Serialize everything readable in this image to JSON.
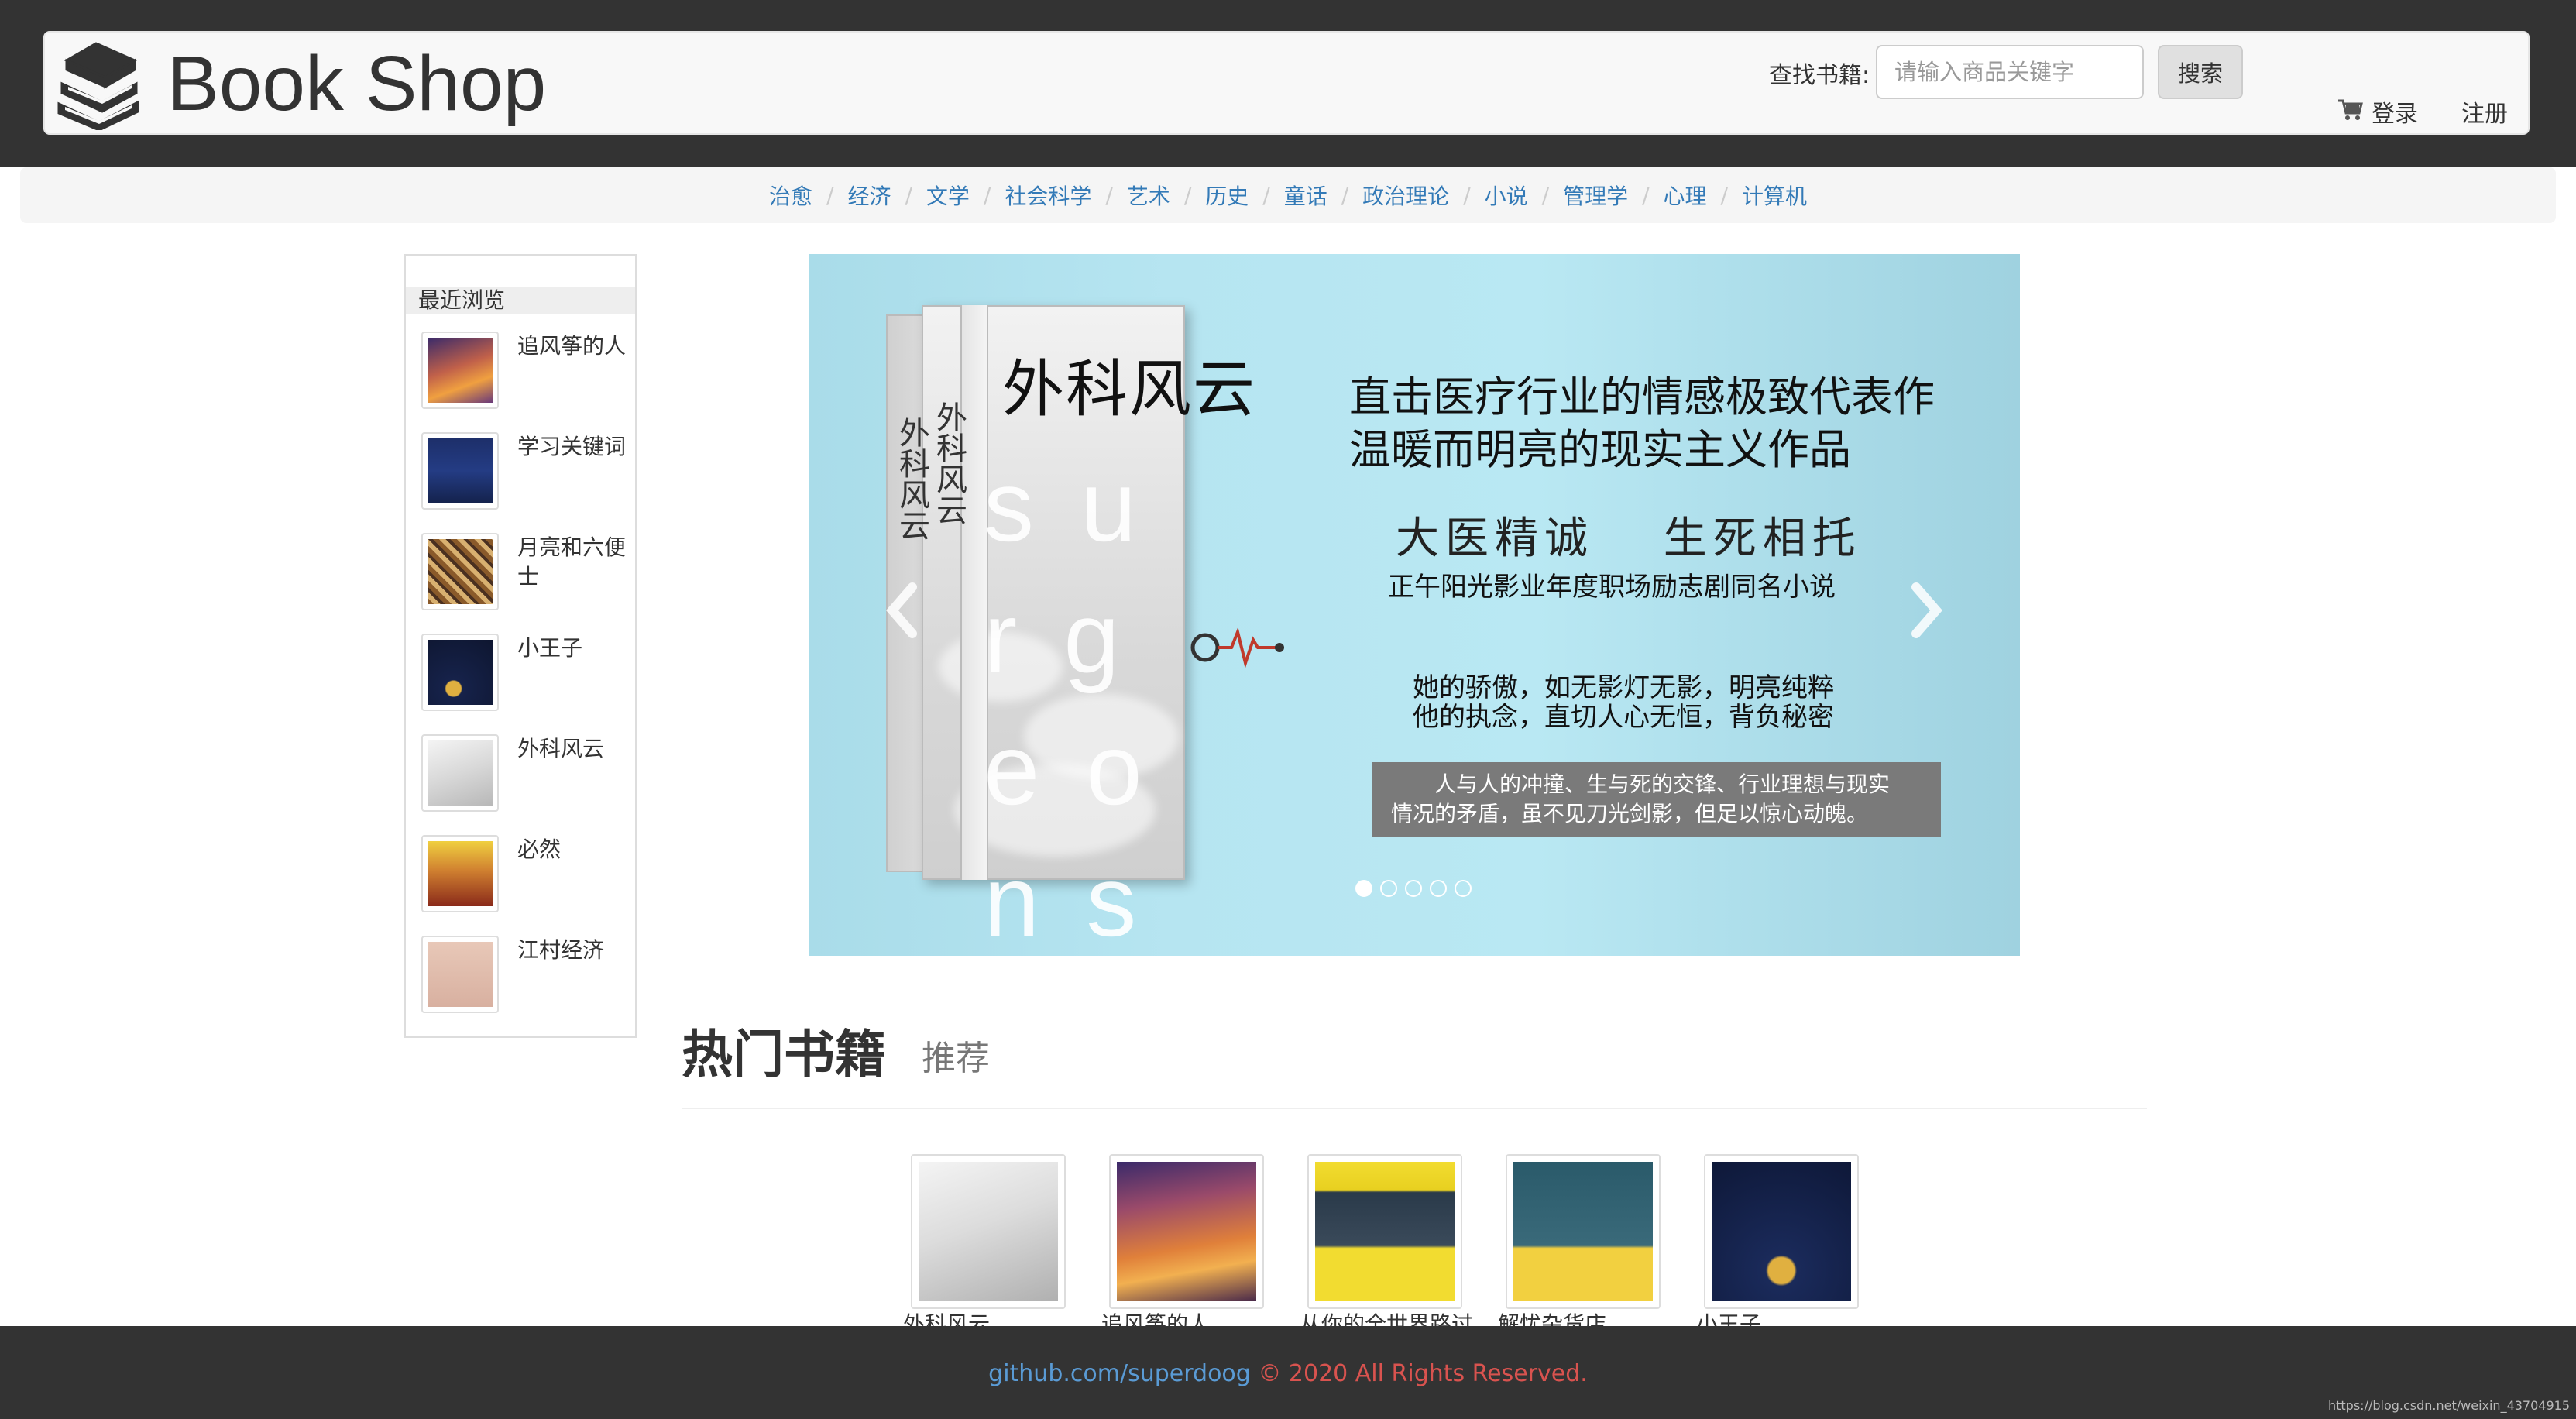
{
  "header": {
    "brand": "Book Shop",
    "search_label": "查找书籍:",
    "search_placeholder": "请输入商品关键字",
    "search_button": "搜索",
    "login": "登录",
    "register": "注册"
  },
  "categories": [
    "治愈",
    "经济",
    "文学",
    "社会科学",
    "艺术",
    "历史",
    "童话",
    "政治理论",
    "小说",
    "管理学",
    "心理",
    "计算机"
  ],
  "sidebar": {
    "title": "最近浏览",
    "items": [
      {
        "title": "追风筝的人"
      },
      {
        "title": "学习关键词"
      },
      {
        "title": "月亮和六便士"
      },
      {
        "title": "小王子"
      },
      {
        "title": "外科风云"
      },
      {
        "title": "必然"
      },
      {
        "title": "江村经济"
      }
    ]
  },
  "carousel": {
    "cover_title": "外科风云",
    "spine_title": "外科风云",
    "cover_word": "surgeons",
    "headline_1": "直击医疗行业的情感极致代表作",
    "headline_2": "温暖而明亮的现实主义作品",
    "slogan": "大医精诚　 生死相托",
    "subtitle": "正午阳光影业年度职场励志剧同名小说",
    "line_1": "她的骄傲，如无影灯无影，明亮纯粹",
    "line_2": "他的执念，直切人心无恒，背负秘密",
    "box_text_1": "人与人的冲撞、生与死的交锋、行业理想与现实",
    "box_text_2": "情况的矛盾，虽不见刀光剑影，但足以惊心动魄。",
    "slide_count": 5,
    "active_slide": 0
  },
  "hot": {
    "title": "热门书籍",
    "subtitle": "推荐",
    "books": [
      {
        "title": "外科风云"
      },
      {
        "title": "追风筝的人"
      },
      {
        "title": "从你的全世界路过"
      },
      {
        "title": "解忧杂货店"
      },
      {
        "title": "小王子"
      }
    ]
  },
  "footer": {
    "link": "github.com/superdoog",
    "copyright": " © 2020 All Rights Reserved."
  },
  "watermark": "https://blog.csdn.net/weixin_43704915",
  "icons": {
    "brand": "book-stack-icon",
    "cart": "shopping-cart-icon",
    "prev": "chevron-left-icon",
    "next": "chevron-right-icon"
  },
  "colors": {
    "header_bg": "#333333",
    "link": "#337ab7",
    "footer_link": "#5a9bd5",
    "footer_copy": "#d9534f"
  }
}
